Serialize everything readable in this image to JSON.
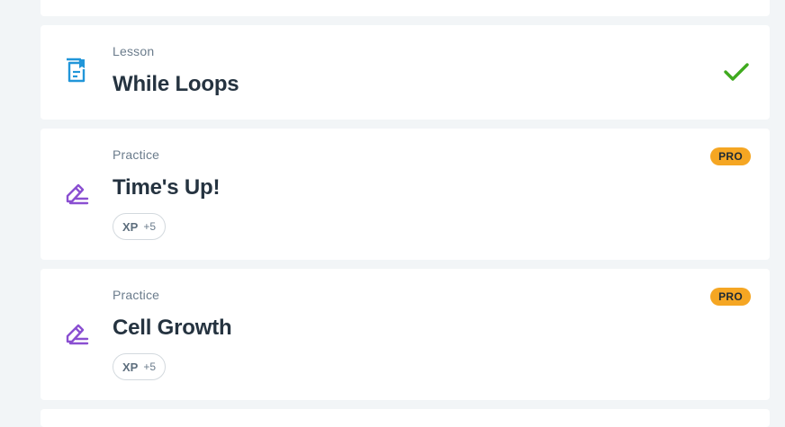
{
  "lessons": [
    {
      "type": "Lesson",
      "title": "While Loops",
      "icon": "document-icon",
      "completed": true
    },
    {
      "type": "Practice",
      "title": "Time's Up!",
      "icon": "pencil-icon",
      "badge": "PRO",
      "xp_label": "XP",
      "xp_value": "+5"
    },
    {
      "type": "Practice",
      "title": "Cell Growth",
      "icon": "pencil-icon",
      "badge": "PRO",
      "xp_label": "XP",
      "xp_value": "+5"
    }
  ],
  "colors": {
    "background": "#f2f5f7",
    "lesson_icon": "#2196d9",
    "practice_icon": "#8a4fd1",
    "check": "#3faa1e",
    "pro_badge": "#f5a623"
  }
}
